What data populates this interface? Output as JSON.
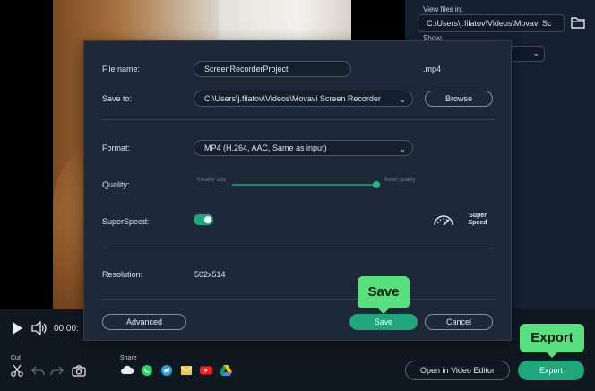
{
  "background": {
    "view_files_label": "View files in:",
    "view_files_path": "C:\\Users\\j.filatov\\Videos\\Movavi Sc",
    "show_label": "Show:",
    "time": "00:00:",
    "cut_label": "Cut",
    "share_label": "Share",
    "share_icons": [
      "cloud-icon",
      "whatsapp-icon",
      "telegram-icon",
      "email-icon",
      "youtube-icon",
      "google-drive-icon"
    ],
    "open_editor_label": "Open in Video Editor",
    "export_label": "Export"
  },
  "callouts": {
    "save": "Save",
    "export": "Export"
  },
  "dialog": {
    "file_name_label": "File name:",
    "file_name_value": "ScreenRecorderProject",
    "extension": ".mp4",
    "save_to_label": "Save to:",
    "save_to_value": "C:\\Users\\j.filatov\\Videos\\Movavi Screen Recorder",
    "browse_label": "Browse",
    "format_label": "Format:",
    "format_value": "MP4 (H.264, AAC, Same as input)",
    "quality_label": "Quality:",
    "quality_smaller": "Smaller size",
    "quality_better": "Better quality",
    "quality_level": 0.98,
    "superspeed_label": "SuperSpeed:",
    "superspeed_on": true,
    "super_speed_text": "Super Speed",
    "resolution_label": "Resolution:",
    "resolution_value": "502x514",
    "advanced_label": "Advanced",
    "save_label": "Save",
    "cancel_label": "Cancel"
  },
  "colors": {
    "accent": "#1fa67a",
    "callout": "#58e07f",
    "dialog_bg": "#1d2838"
  }
}
